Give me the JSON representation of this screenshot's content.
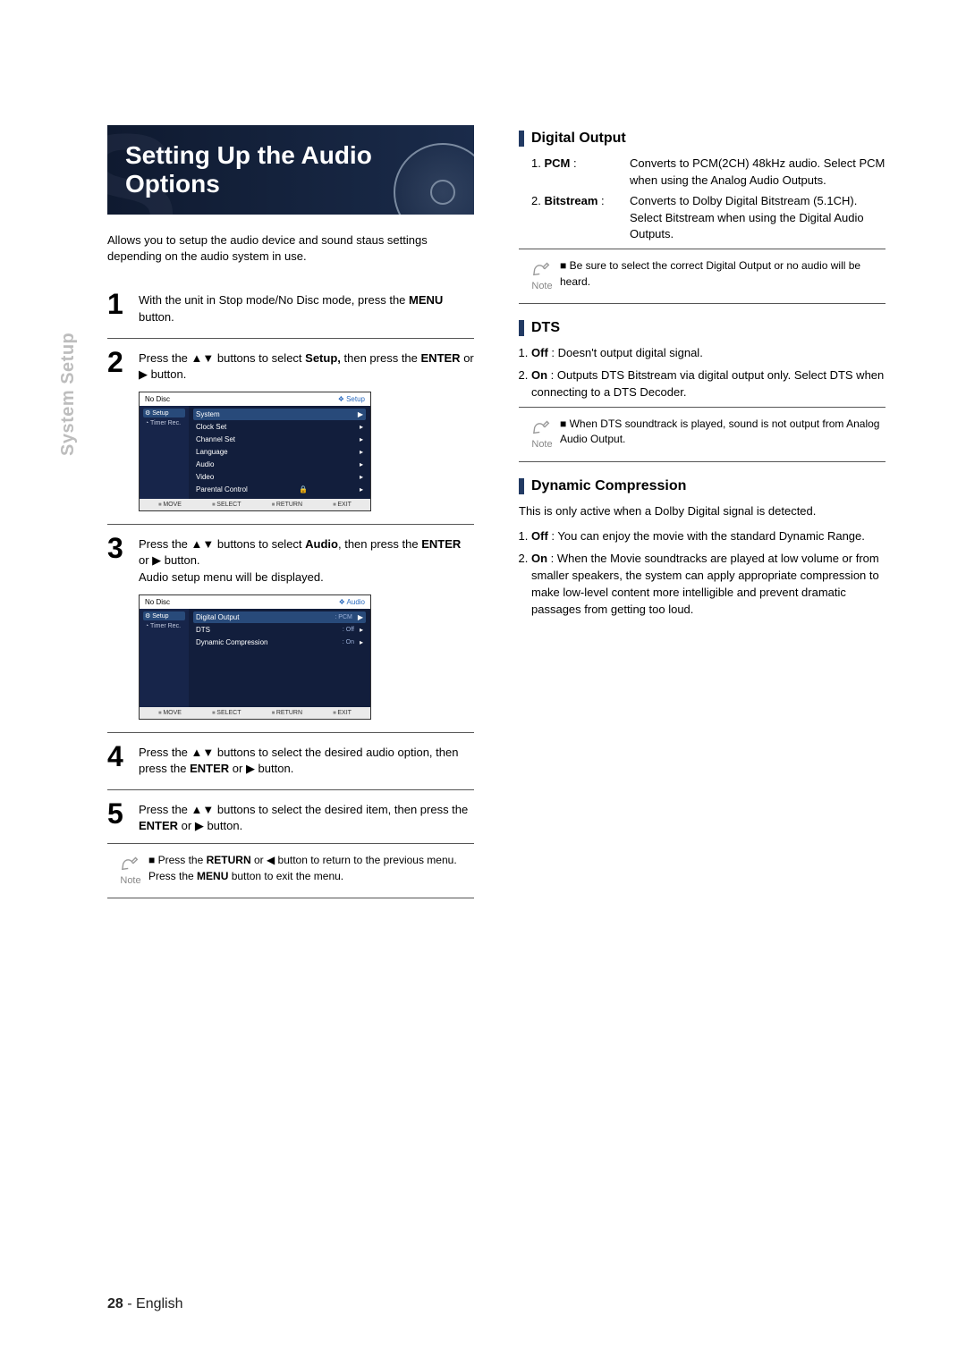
{
  "sidebar_label": "System Setup",
  "title": "Setting Up the Audio Options",
  "intro": "Allows you to setup the audio device and sound staus settings depending on the audio system in use.",
  "steps": {
    "s1": {
      "num": "1",
      "pre": "With the unit in Stop mode/No Disc mode, press the ",
      "bold": "MENU",
      "post": " button."
    },
    "s2": {
      "num": "2",
      "pre": "Press the ▲▼ buttons to select ",
      "bold1": "Setup,",
      "mid": " then press the ",
      "bold2": "ENTER",
      "post": " or ▶ button."
    },
    "s3": {
      "num": "3",
      "pre": "Press the ▲▼ buttons to select ",
      "bold1": "Audio",
      "mid": ", then press the  ",
      "bold2": "ENTER",
      "post": " or ▶ button.",
      "sub": "Audio setup menu will be displayed."
    },
    "s4": {
      "num": "4",
      "pre": "Press the ▲▼ buttons to select the desired audio option, then press the ",
      "bold": "ENTER",
      "post": " or ▶ button."
    },
    "s5": {
      "num": "5",
      "pre": "Press the ▲▼ buttons to select the desired item, then press the ",
      "bold": "ENTER",
      "post": " or ▶ button."
    }
  },
  "osd1": {
    "no_disc": "No Disc",
    "crumb_icon": "❖",
    "crumb": "Setup",
    "side_sel": "Setup",
    "side_item": "Timer Rec.",
    "rows": [
      "System",
      "Clock Set",
      "Channel Set",
      "Language",
      "Audio",
      "Video",
      "Parental Control"
    ],
    "foot": {
      "move": "MOVE",
      "select": "SELECT",
      "ret": "RETURN",
      "exit": "EXIT"
    }
  },
  "osd2": {
    "no_disc": "No Disc",
    "crumb_icon": "❖",
    "crumb": "Audio",
    "side_sel": "Setup",
    "side_item": "Timer Rec.",
    "rows": [
      {
        "label": "Digital Output",
        "val": ": PCM"
      },
      {
        "label": "DTS",
        "val": ": Off"
      },
      {
        "label": "Dynamic Compression",
        "val": ": On"
      }
    ],
    "foot": {
      "move": "MOVE",
      "select": "SELECT",
      "ret": "RETURN",
      "exit": "EXIT"
    }
  },
  "note_left": {
    "label": "Note",
    "line1_pre": "Press the ",
    "line1_b1": "RETURN",
    "line1_mid": " or ◀ button to return to the previous menu.",
    "line2_pre": "Press the ",
    "line2_b": "MENU",
    "line2_post": " button to exit the menu."
  },
  "digital_output": {
    "heading": "Digital Output",
    "r1_num": "1.",
    "r1_lab": "PCM",
    "r1_colon": " : ",
    "r1_txt": "Converts to PCM(2CH) 48kHz audio. Select PCM when using the Analog Audio Outputs.",
    "r2_num": "2.",
    "r2_lab": "Bitstream",
    "r2_colon": " : ",
    "r2_txt": "Converts to Dolby Digital Bitstream (5.1CH). Select Bitstream when using the Digital Audio Outputs.",
    "note": "Be sure to select the correct Digital Output or no audio will be heard.",
    "note_label": "Note"
  },
  "dts": {
    "heading": "DTS",
    "i1_b": "Off",
    "i1_txt": " : Doesn't output digital signal.",
    "i2_b": "On",
    "i2_txt": " : Outputs DTS Bitstream via digital output only. Select DTS when connecting to a DTS Decoder.",
    "note": "When DTS soundtrack is played, sound is not output from Analog Audio Output.",
    "note_label": "Note"
  },
  "dyn": {
    "heading": "Dynamic Compression",
    "intro": "This is only active when a Dolby Digital signal is detected.",
    "i1_b": "Off",
    "i1_txt": " : You can enjoy the movie with the standard Dynamic Range.",
    "i2_b": "On",
    "i2_txt": " : When the Movie soundtracks are played at low volume or from smaller speakers, the system can apply appropriate compression to make low-level content more intelligible and prevent dramatic passages from getting too loud."
  },
  "footer": {
    "page": "28",
    "dash": " - ",
    "lang": "English"
  }
}
